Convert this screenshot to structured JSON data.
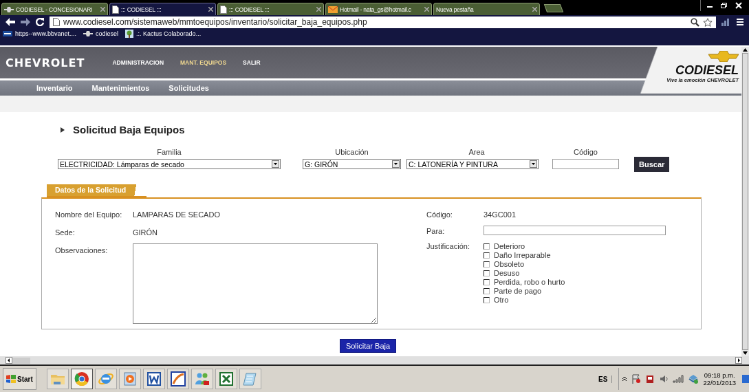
{
  "browser": {
    "tabs": [
      {
        "label": "CODIESEL - CONCESIONARI",
        "kind": "brand",
        "selected": false
      },
      {
        "label": "::: CODIESEL :::",
        "kind": "page",
        "selected": true
      },
      {
        "label": "::: CODIESEL :::",
        "kind": "page",
        "selected": false
      },
      {
        "label": "Hotmail - nata_gs@hotmail.c",
        "kind": "mail",
        "selected": false
      },
      {
        "label": "Nueva pestaña",
        "kind": "blank",
        "selected": false
      }
    ],
    "url": "www.codiesel.com/sistemaweb/mmtoequipos/inventario/solicitar_baja_equipos.php",
    "bookmarks": [
      {
        "label": "https--www.bbvanet....",
        "kind": "bank"
      },
      {
        "label": "codiesel",
        "kind": "brand"
      },
      {
        "label": ".:. Kactus Colaborado...",
        "kind": "tree"
      }
    ]
  },
  "header": {
    "brand": "CHEVROLET",
    "menu": [
      {
        "label": "ADMINISTRACION",
        "selected": false
      },
      {
        "label": "MANT. EQUIPOS",
        "selected": true
      },
      {
        "label": "SALIR",
        "selected": false
      }
    ],
    "logo": "CODIESEL",
    "tagline": "Vive la emoción CHEVROLET",
    "submenu": [
      "Inventario",
      "Mantenimientos",
      "Solicitudes"
    ]
  },
  "title": "Solicitud Baja Equipos",
  "filters": [
    {
      "label": "Familia",
      "kind": "select",
      "value": "ELECTRICIDAD: Lámparas de secado"
    },
    {
      "label": "Ubicación",
      "kind": "select",
      "value": "G: GIRÓN"
    },
    {
      "label": "Area",
      "kind": "select",
      "value": "C: LATONERÍA Y PINTURA"
    },
    {
      "label": "Código",
      "kind": "input"
    }
  ],
  "search_button": "Buscar",
  "section_tab": "Datos de la Solicitud",
  "details": [
    {
      "label": "Nombre del Equipo:",
      "value": "LAMPARAS DE SECADO"
    },
    {
      "label": "Sede:",
      "value": "GIRÓN"
    }
  ],
  "observations_label": "Observaciones:",
  "code": {
    "label": "Código:",
    "value": "34GC001"
  },
  "para_label": "Para:",
  "justification": {
    "label": "Justificación:",
    "options": [
      {
        "label": "Deterioro",
        "checked": false
      },
      {
        "label": "Daño Irreparable",
        "checked": false
      },
      {
        "label": "Obsoleto",
        "checked": false
      },
      {
        "label": "Desuso",
        "checked": false
      },
      {
        "label": "Perdida, robo o hurto",
        "checked": false
      },
      {
        "label": "Parte de pago",
        "checked": false
      },
      {
        "label": "Otro",
        "checked": false
      }
    ]
  },
  "submit_button": "Solicitar Baja",
  "taskbar": {
    "start": "Start",
    "apps": [
      {
        "kind": "folder",
        "selected": false
      },
      {
        "kind": "chrome",
        "selected": true
      },
      {
        "kind": "ie",
        "selected": false
      },
      {
        "kind": "media",
        "selected": false
      },
      {
        "kind": "word",
        "selected": false
      },
      {
        "kind": "pen",
        "selected": false
      },
      {
        "kind": "people",
        "selected": false
      },
      {
        "kind": "excel",
        "selected": false
      },
      {
        "kind": "notepad",
        "selected": false
      }
    ],
    "language": "ES",
    "time": "09:18 p.m.",
    "date": "22/01/2013"
  }
}
